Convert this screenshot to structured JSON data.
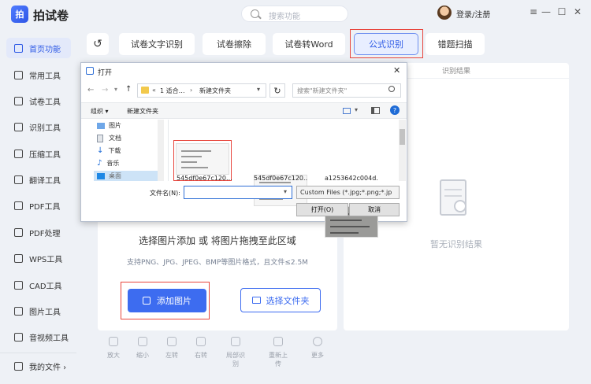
{
  "app": {
    "name": "拍试卷",
    "logo_char": "拍",
    "search_placeholder": "搜索功能",
    "login_label": "登录/注册"
  },
  "window_controls": [
    "≡",
    "—",
    "☐",
    "✕"
  ],
  "sidebar": {
    "items": [
      {
        "label": "首页功能",
        "icon": "home-icon",
        "active": true
      },
      {
        "label": "常用工具",
        "icon": "layers-icon"
      },
      {
        "label": "试卷工具",
        "icon": "paper-icon"
      },
      {
        "label": "识别工具",
        "icon": "scan-icon"
      },
      {
        "label": "压缩工具",
        "icon": "compress-icon"
      },
      {
        "label": "翻译工具",
        "icon": "translate-icon"
      },
      {
        "label": "PDF工具",
        "icon": "pdf-icon"
      },
      {
        "label": "PDF处理",
        "icon": "pdf-process-icon"
      },
      {
        "label": "WPS工具",
        "icon": "wps-icon"
      },
      {
        "label": "CAD工具",
        "icon": "cad-icon"
      },
      {
        "label": "图片工具",
        "icon": "image-icon"
      },
      {
        "label": "音视频工具",
        "icon": "media-icon"
      }
    ],
    "my_files": "我的文件 ›"
  },
  "toolbar": {
    "back": "↺",
    "tabs": [
      {
        "label": "试卷文字识别"
      },
      {
        "label": "试卷擦除"
      },
      {
        "label": "试卷转Word"
      },
      {
        "label": "公式识别",
        "active": true
      },
      {
        "label": "错题扫描"
      }
    ]
  },
  "result": {
    "header": "识别结果",
    "empty_text": "暂无识别结果"
  },
  "upload": {
    "prompt": "选择图片添加 或 将图片拖拽至此区域",
    "support_text": "支持PNG、JPG、JPEG、BMP等图片格式，且文件≤2.5M",
    "add_button": "添加图片",
    "choose_folder_button": "选择文件夹"
  },
  "bottom_tools": [
    "放大",
    "缩小",
    "左转",
    "右转",
    "局部识别",
    "重新上传",
    "更多"
  ],
  "dialog": {
    "title": "打开",
    "breadcrumb": [
      "«",
      "1 适合…",
      "›",
      "新建文件夹"
    ],
    "search_placeholder": "搜索\"新建文件夹\"",
    "organize": "组织 ▾",
    "new_folder": "新建文件夹",
    "tree": [
      {
        "label": "图片",
        "icon": "pictures-icon"
      },
      {
        "label": "文档",
        "icon": "documents-icon"
      },
      {
        "label": "下载",
        "icon": "downloads-icon"
      },
      {
        "label": "音乐",
        "icon": "music-icon"
      },
      {
        "label": "桌面",
        "icon": "desktop-icon"
      }
    ],
    "files": [
      {
        "name": "545df0e67c120...",
        "selected": true
      },
      {
        "name": "545df0e67c120...",
        "selected": false
      },
      {
        "name": "a1253642c004d...",
        "selected": false
      }
    ],
    "filename_label": "文件名(N):",
    "filename_value": "",
    "filetype": "Custom Files (*.jpg;*.png;*.jp",
    "open_button": "打开(O)",
    "cancel_button": "取消"
  }
}
